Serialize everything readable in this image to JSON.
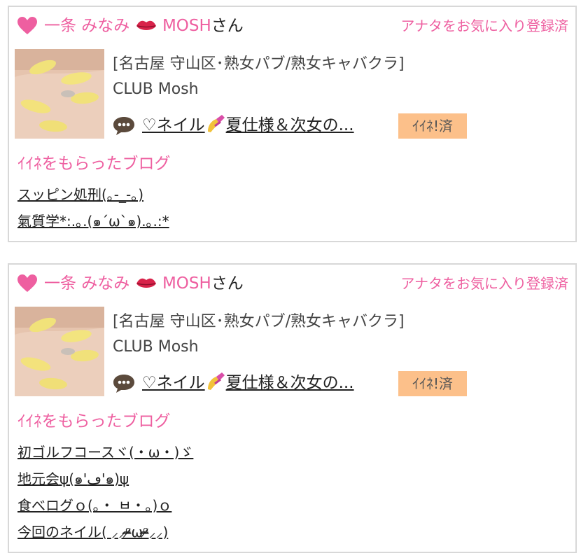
{
  "cards": [
    {
      "name_prefix": "一条 みなみ",
      "name_suffix": "MOSH",
      "name_honorific": "さん",
      "favorite_status": "アナタをお気に入り登録済",
      "shop_area": "[名古屋 守山区･熟女パブ/熟女キャバクラ]",
      "shop_name": "CLUB Mosh",
      "post_title_prefix": "♡ネイル",
      "post_title_suffix": "夏仕様＆次女の...",
      "iine_badge": "ｲｲﾈ!済",
      "section_title": "ｲｲﾈをもらったブログ",
      "blog_posts": [
        "スッピン処刑(｡-_-｡)",
        "氣質学*:.｡.(๑´ω`๑).｡.:*"
      ]
    },
    {
      "name_prefix": "一条 みなみ",
      "name_suffix": "MOSH",
      "name_honorific": "さん",
      "favorite_status": "アナタをお気に入り登録済",
      "shop_area": "[名古屋 守山区･熟女パブ/熟女キャバクラ]",
      "shop_name": "CLUB Mosh",
      "post_title_prefix": "♡ネイル",
      "post_title_suffix": "夏仕様＆次女の...",
      "iine_badge": "ｲｲﾈ!済",
      "section_title": "ｲｲﾈをもらったブログ",
      "blog_posts": [
        "初ゴルフコースヾ(・ω・)ゞ",
        "地元会ψ(๑'ڡ'๑)ψ",
        "食べログｏ(｡・ ㅂ・｡)ｏ",
        "今回のネイル( ⸝⸝ᵒ̴̶̷ωᵒ̴̶̷⸝⸝)"
      ]
    }
  ],
  "colors": {
    "accent_pink": "#ee5fa0",
    "badge_orange": "#fcc08a",
    "border": "#d8d8d8"
  },
  "icons": [
    "heart-icon",
    "lips-emoji-icon",
    "nail-polish-emoji-icon",
    "speech-bubble-icon"
  ]
}
